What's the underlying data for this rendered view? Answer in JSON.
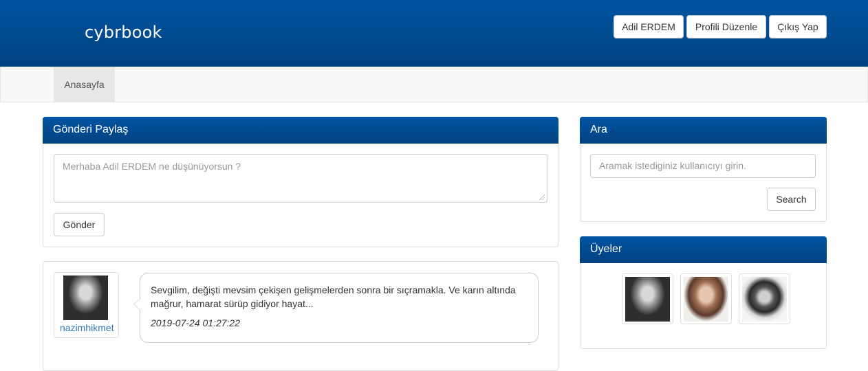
{
  "header": {
    "brand": "cybrbook",
    "user_button": "Adil ERDEM",
    "edit_profile_button": "Profili Düzenle",
    "logout_button": "Çıkış Yap"
  },
  "nav": {
    "items": [
      {
        "label": "Anasayfa"
      }
    ]
  },
  "share_panel": {
    "title": "Gönderi Paylaş",
    "textarea_placeholder": "Merhaba Adil ERDEM ne düşünüyorsun ?",
    "submit_label": "Gönder"
  },
  "posts": [
    {
      "username": "nazimhikmet",
      "text": "Sevgilim, değişti mevsim çekişen gelişmelerden sonra bir sıçramakla. Ve karın altında mağrur, hamarat sürüp gidiyor hayat...",
      "date": "2019-07-24 01:27:22"
    }
  ],
  "search_panel": {
    "title": "Ara",
    "placeholder": "Aramak istediginiz kullanıcıyı girin.",
    "button_label": "Search"
  },
  "members_panel": {
    "title": "Üyeler"
  },
  "colors": {
    "header_gradient_top": "#0154a3",
    "header_gradient_bottom": "#01427f",
    "link": "#337ab7"
  }
}
